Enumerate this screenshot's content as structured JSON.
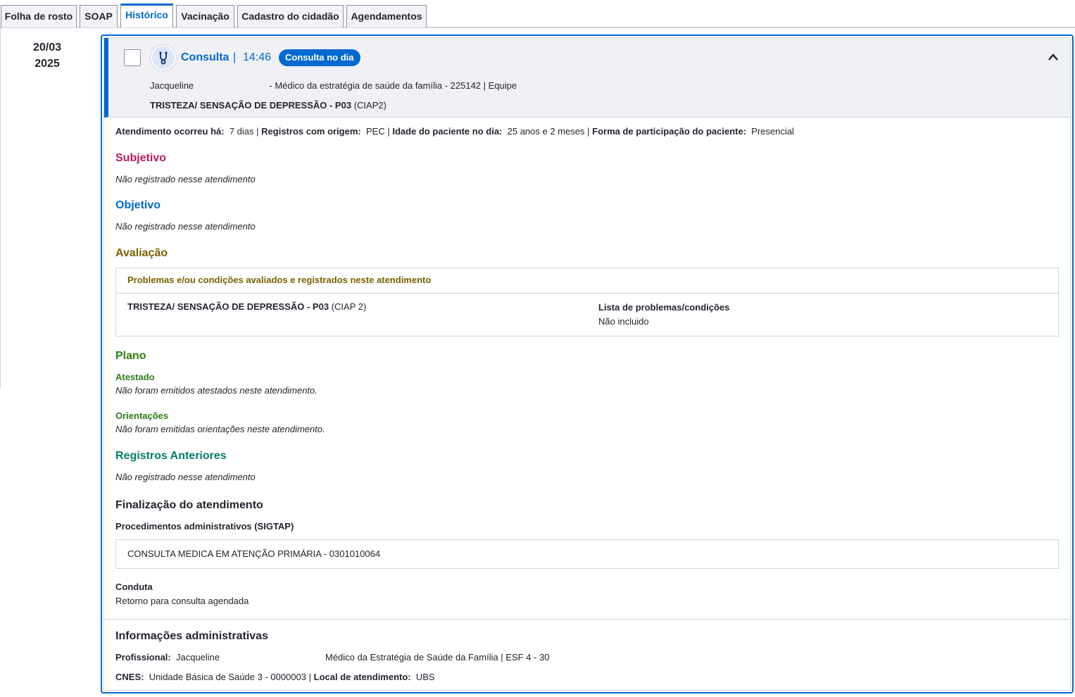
{
  "tabs": [
    {
      "label": "Folha de rosto",
      "active": false
    },
    {
      "label": "SOAP",
      "active": false
    },
    {
      "label": "Histórico",
      "active": true
    },
    {
      "label": "Vacinação",
      "active": false
    },
    {
      "label": "Cadastro do cidadão",
      "active": false
    },
    {
      "label": "Agendamentos",
      "active": false
    }
  ],
  "date": {
    "day_month": "20/03",
    "year": "2025"
  },
  "header": {
    "title": "Consulta",
    "separator": "|",
    "time": "14:46",
    "badge": "Consulta no dia",
    "professional_name": "Jacqueline",
    "professional_role": "- Médico da estratégia de saúde da família - 225142 | Equipe",
    "diagnosis": "TRISTEZA/ SENSAÇÃO DE DEPRESSÃO - P03",
    "diagnosis_code": "(CIAP2)",
    "icon": "stethoscope-icon",
    "collapse_icon": "chevron-up-icon"
  },
  "info": {
    "ocorreu_label": "Atendimento ocorreu há:",
    "ocorreu_value": "7 dias",
    "origem_label": "Registros com origem:",
    "origem_value": "PEC",
    "idade_label": "Idade do paciente no dia:",
    "idade_value": "25 anos e 2 meses",
    "participacao_label": "Forma de participação do paciente:",
    "participacao_value": "Presencial",
    "sep": "|"
  },
  "subjetivo": {
    "title": "Subjetivo",
    "text": "Não registrado nesse atendimento",
    "color": "#c0185e"
  },
  "objetivo": {
    "title": "Objetivo",
    "text": "Não registrado nesse atendimento",
    "color": "#0069d0"
  },
  "avaliacao": {
    "title": "Avaliação",
    "color": "#7a6200",
    "box_title": "Problemas e/ou condições avaliados e registrados neste atendimento",
    "diagnosis": "TRISTEZA/ SENSAÇÃO DE DEPRESSÃO - P03",
    "diagnosis_code": "(CIAP 2)",
    "lista_label": "Lista de problemas/condições",
    "lista_value": "Não incluido"
  },
  "plano": {
    "title": "Plano",
    "color": "#2e7d13",
    "atestado_label": "Atestado",
    "atestado_text": "Não foram emitidos atestados neste atendimento.",
    "orientacoes_label": "Orientações",
    "orientacoes_text": "Não foram emitidas orientações neste atendimento."
  },
  "registros_anteriores": {
    "title": "Registros Anteriores",
    "text": "Não registrado nesse atendimento",
    "color": "#037d6f"
  },
  "finalizacao": {
    "title": "Finalização do atendimento",
    "procedimentos_label": "Procedimentos administrativos (SIGTAP)",
    "procedimento": "CONSULTA MEDICA EM ATENÇÃO PRIMÁRIA - 0301010064",
    "conduta_label": "Conduta",
    "conduta_value": "Retorno para consulta agendada"
  },
  "admin": {
    "title": "Informações administrativas",
    "profissional_label": "Profissional:",
    "profissional_value": "Jacqueline",
    "profissional_role": "Médico da Estratégia de Saúde da Família | ESF 4 - 30",
    "cnes_label": "CNES:",
    "cnes_value": "Unidade Básica de Saúde 3 - 0000003",
    "sep": "|",
    "local_label": "Local de atendimento:",
    "local_value": "UBS"
  }
}
